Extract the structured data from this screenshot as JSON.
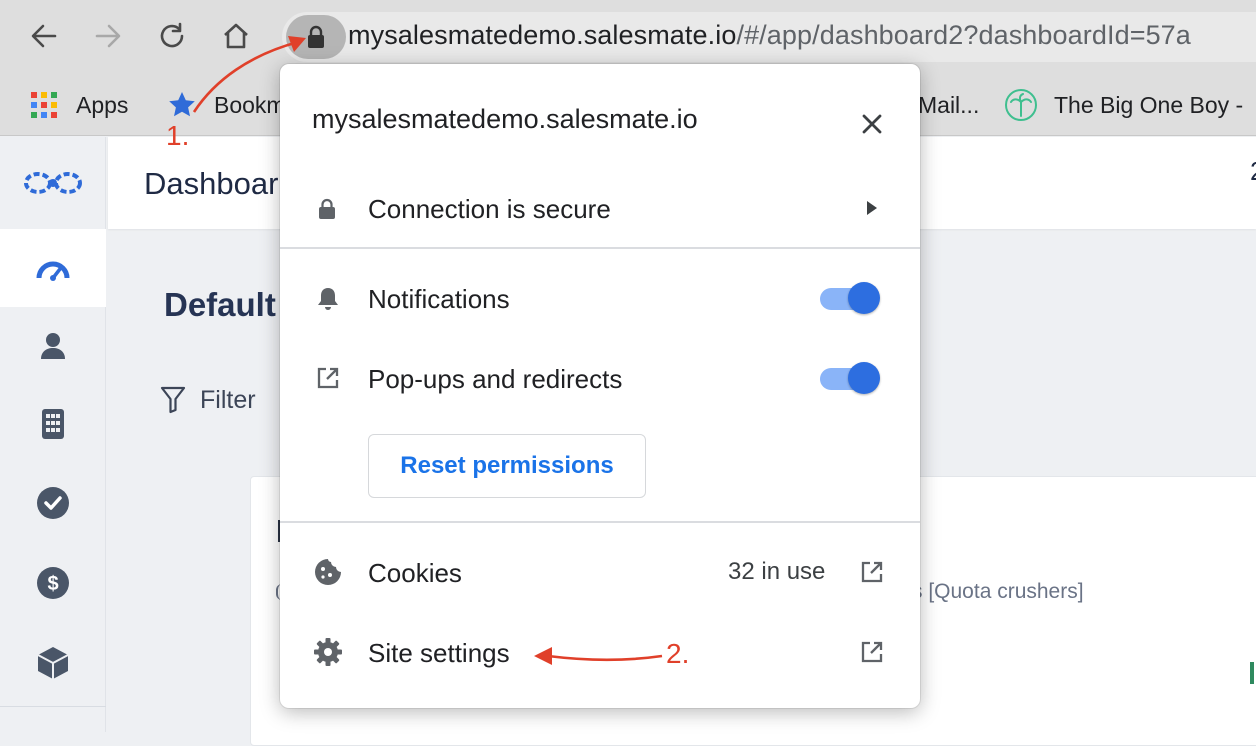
{
  "browser": {
    "url_host": "mysalesmatedemo.salesmate.io",
    "url_path": "/#/app/dashboard2?dashboardId=57a",
    "bookmarks": [
      {
        "label": "Apps",
        "icon": "apps-grid-icon"
      },
      {
        "label": "Bookm",
        "icon": "bookmark-star-icon"
      },
      {
        "label": "Mail...",
        "icon": ""
      },
      {
        "label": "The Big One Boy -",
        "icon": "palm-tree-icon"
      }
    ]
  },
  "app": {
    "header_title": "Dashboar",
    "page_title": "Default",
    "filter_label": "Filter",
    "card_text": "s [Quota crushers]",
    "header_right_text": "2",
    "sidebar_icons": [
      "logo-icon",
      "dashboard-speedometer-icon",
      "contacts-person-icon",
      "calculator-icon",
      "tasks-check-icon",
      "deals-dollar-icon",
      "products-cube-icon"
    ],
    "colors": {
      "brand": "#2f6bd8",
      "sidebar_icon": "#4a5668"
    }
  },
  "popup": {
    "title": "mysalesmatedemo.salesmate.io",
    "connection_label": "Connection is secure",
    "notifications_label": "Notifications",
    "notifications_enabled": true,
    "popups_label": "Pop-ups and redirects",
    "popups_enabled": true,
    "reset_label": "Reset permissions",
    "cookies_label": "Cookies",
    "cookies_count": "32 in use",
    "site_settings_label": "Site settings",
    "colors": {
      "toggle_on": "#2d6ee0",
      "link": "#1a73e8"
    }
  },
  "annotations": {
    "step1": "1.",
    "step2": "2.",
    "color": "#e0402a"
  }
}
